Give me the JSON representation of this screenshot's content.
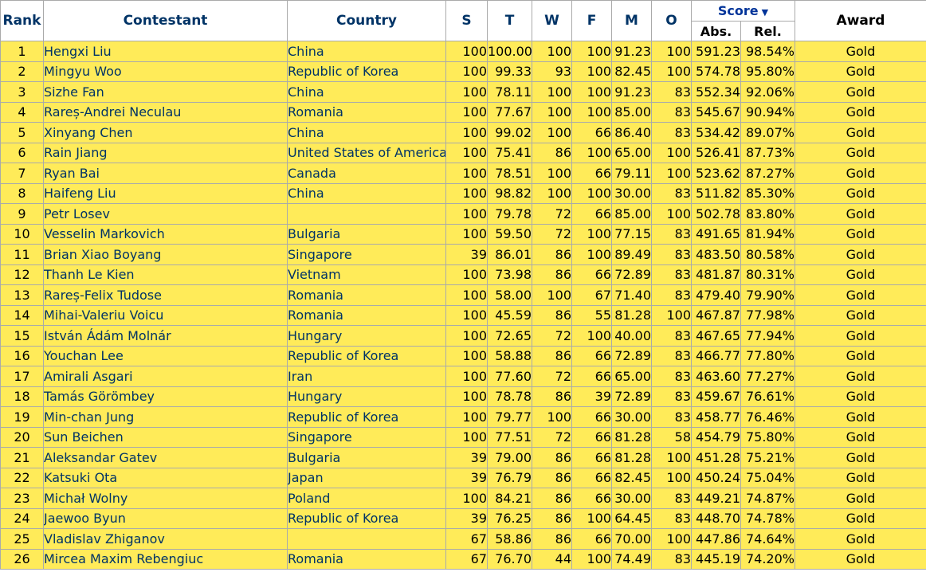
{
  "headers": {
    "rank": "Rank",
    "contestant": "Contestant",
    "country": "Country",
    "s": "S",
    "t": "T",
    "w": "W",
    "f": "F",
    "m": "M",
    "o": "O",
    "score": "Score",
    "score_sort_indicator": "▼",
    "abs": "Abs.",
    "rel": "Rel.",
    "award": "Award"
  },
  "colors": {
    "row_background": "#ffeb59",
    "header_link": "#003366",
    "grid_border": "#aaaaaa"
  },
  "rows": [
    {
      "rank": "1",
      "name": "Hengxi Liu",
      "country": "China",
      "s": "100",
      "t": "100.00",
      "w": "100",
      "f": "100",
      "m": "91.23",
      "o": "100",
      "abs": "591.23",
      "rel": "98.54%",
      "award": "Gold"
    },
    {
      "rank": "2",
      "name": "Mingyu Woo",
      "country": "Republic of Korea",
      "s": "100",
      "t": "99.33",
      "w": "93",
      "f": "100",
      "m": "82.45",
      "o": "100",
      "abs": "574.78",
      "rel": "95.80%",
      "award": "Gold"
    },
    {
      "rank": "3",
      "name": "Sizhe Fan",
      "country": "China",
      "s": "100",
      "t": "78.11",
      "w": "100",
      "f": "100",
      "m": "91.23",
      "o": "83",
      "abs": "552.34",
      "rel": "92.06%",
      "award": "Gold"
    },
    {
      "rank": "4",
      "name": "Rareș-Andrei Neculau",
      "country": "Romania",
      "s": "100",
      "t": "77.67",
      "w": "100",
      "f": "100",
      "m": "85.00",
      "o": "83",
      "abs": "545.67",
      "rel": "90.94%",
      "award": "Gold"
    },
    {
      "rank": "5",
      "name": "Xinyang Chen",
      "country": "China",
      "s": "100",
      "t": "99.02",
      "w": "100",
      "f": "66",
      "m": "86.40",
      "o": "83",
      "abs": "534.42",
      "rel": "89.07%",
      "award": "Gold"
    },
    {
      "rank": "6",
      "name": "Rain Jiang",
      "country": "United States of America",
      "s": "100",
      "t": "75.41",
      "w": "86",
      "f": "100",
      "m": "65.00",
      "o": "100",
      "abs": "526.41",
      "rel": "87.73%",
      "award": "Gold"
    },
    {
      "rank": "7",
      "name": "Ryan Bai",
      "country": "Canada",
      "s": "100",
      "t": "78.51",
      "w": "100",
      "f": "66",
      "m": "79.11",
      "o": "100",
      "abs": "523.62",
      "rel": "87.27%",
      "award": "Gold"
    },
    {
      "rank": "8",
      "name": "Haifeng Liu",
      "country": "China",
      "s": "100",
      "t": "98.82",
      "w": "100",
      "f": "100",
      "m": "30.00",
      "o": "83",
      "abs": "511.82",
      "rel": "85.30%",
      "award": "Gold"
    },
    {
      "rank": "9",
      "name": "Petr Losev",
      "country": "",
      "s": "100",
      "t": "79.78",
      "w": "72",
      "f": "66",
      "m": "85.00",
      "o": "100",
      "abs": "502.78",
      "rel": "83.80%",
      "award": "Gold"
    },
    {
      "rank": "10",
      "name": "Vesselin Markovich",
      "country": "Bulgaria",
      "s": "100",
      "t": "59.50",
      "w": "72",
      "f": "100",
      "m": "77.15",
      "o": "83",
      "abs": "491.65",
      "rel": "81.94%",
      "award": "Gold"
    },
    {
      "rank": "11",
      "name": "Brian Xiao Boyang",
      "country": "Singapore",
      "s": "39",
      "t": "86.01",
      "w": "86",
      "f": "100",
      "m": "89.49",
      "o": "83",
      "abs": "483.50",
      "rel": "80.58%",
      "award": "Gold"
    },
    {
      "rank": "12",
      "name": "Thanh Le Kien",
      "country": "Vietnam",
      "s": "100",
      "t": "73.98",
      "w": "86",
      "f": "66",
      "m": "72.89",
      "o": "83",
      "abs": "481.87",
      "rel": "80.31%",
      "award": "Gold"
    },
    {
      "rank": "13",
      "name": "Rareș-Felix Tudose",
      "country": "Romania",
      "s": "100",
      "t": "58.00",
      "w": "100",
      "f": "67",
      "m": "71.40",
      "o": "83",
      "abs": "479.40",
      "rel": "79.90%",
      "award": "Gold"
    },
    {
      "rank": "14",
      "name": "Mihai-Valeriu Voicu",
      "country": "Romania",
      "s": "100",
      "t": "45.59",
      "w": "86",
      "f": "55",
      "m": "81.28",
      "o": "100",
      "abs": "467.87",
      "rel": "77.98%",
      "award": "Gold"
    },
    {
      "rank": "15",
      "name": "István Ádám Molnár",
      "country": "Hungary",
      "s": "100",
      "t": "72.65",
      "w": "72",
      "f": "100",
      "m": "40.00",
      "o": "83",
      "abs": "467.65",
      "rel": "77.94%",
      "award": "Gold"
    },
    {
      "rank": "16",
      "name": "Youchan Lee",
      "country": "Republic of Korea",
      "s": "100",
      "t": "58.88",
      "w": "86",
      "f": "66",
      "m": "72.89",
      "o": "83",
      "abs": "466.77",
      "rel": "77.80%",
      "award": "Gold"
    },
    {
      "rank": "17",
      "name": "Amirali Asgari",
      "country": "Iran",
      "s": "100",
      "t": "77.60",
      "w": "72",
      "f": "66",
      "m": "65.00",
      "o": "83",
      "abs": "463.60",
      "rel": "77.27%",
      "award": "Gold"
    },
    {
      "rank": "18",
      "name": "Tamás Görömbey",
      "country": "Hungary",
      "s": "100",
      "t": "78.78",
      "w": "86",
      "f": "39",
      "m": "72.89",
      "o": "83",
      "abs": "459.67",
      "rel": "76.61%",
      "award": "Gold"
    },
    {
      "rank": "19",
      "name": "Min-chan Jung",
      "country": "Republic of Korea",
      "s": "100",
      "t": "79.77",
      "w": "100",
      "f": "66",
      "m": "30.00",
      "o": "83",
      "abs": "458.77",
      "rel": "76.46%",
      "award": "Gold"
    },
    {
      "rank": "20",
      "name": "Sun Beichen",
      "country": "Singapore",
      "s": "100",
      "t": "77.51",
      "w": "72",
      "f": "66",
      "m": "81.28",
      "o": "58",
      "abs": "454.79",
      "rel": "75.80%",
      "award": "Gold"
    },
    {
      "rank": "21",
      "name": "Aleksandar Gatev",
      "country": "Bulgaria",
      "s": "39",
      "t": "79.00",
      "w": "86",
      "f": "66",
      "m": "81.28",
      "o": "100",
      "abs": "451.28",
      "rel": "75.21%",
      "award": "Gold"
    },
    {
      "rank": "22",
      "name": "Katsuki Ota",
      "country": "Japan",
      "s": "39",
      "t": "76.79",
      "w": "86",
      "f": "66",
      "m": "82.45",
      "o": "100",
      "abs": "450.24",
      "rel": "75.04%",
      "award": "Gold"
    },
    {
      "rank": "23",
      "name": "Michał Wolny",
      "country": "Poland",
      "s": "100",
      "t": "84.21",
      "w": "86",
      "f": "66",
      "m": "30.00",
      "o": "83",
      "abs": "449.21",
      "rel": "74.87%",
      "award": "Gold"
    },
    {
      "rank": "24",
      "name": "Jaewoo Byun",
      "country": "Republic of Korea",
      "s": "39",
      "t": "76.25",
      "w": "86",
      "f": "100",
      "m": "64.45",
      "o": "83",
      "abs": "448.70",
      "rel": "74.78%",
      "award": "Gold"
    },
    {
      "rank": "25",
      "name": "Vladislav Zhiganov",
      "country": "",
      "s": "67",
      "t": "58.86",
      "w": "86",
      "f": "66",
      "m": "70.00",
      "o": "100",
      "abs": "447.86",
      "rel": "74.64%",
      "award": "Gold"
    },
    {
      "rank": "26",
      "name": "Mircea Maxim Rebengiuc",
      "country": "Romania",
      "s": "67",
      "t": "76.70",
      "w": "44",
      "f": "100",
      "m": "74.49",
      "o": "83",
      "abs": "445.19",
      "rel": "74.20%",
      "award": "Gold"
    }
  ]
}
